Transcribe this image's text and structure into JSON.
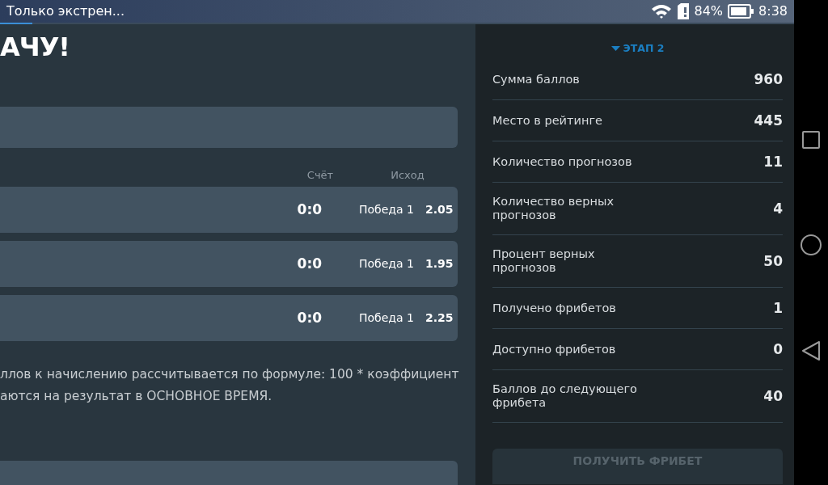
{
  "status_bar": {
    "notification": "Только экстрен...",
    "battery": "84%",
    "time": "8:38"
  },
  "main": {
    "title": "АЧУ!",
    "columns": [
      "Счёт",
      "Исход"
    ],
    "matches": [
      {
        "score": "0:0",
        "outcome": "Победа 1",
        "odds": "2.05"
      },
      {
        "score": "0:0",
        "outcome": "Победа 1",
        "odds": "1.95"
      },
      {
        "score": "0:0",
        "outcome": "Победа 1",
        "odds": "2.25"
      }
    ],
    "notes": [
      "ллов к начислению рассчитывается по формуле: 100 * коэффициент",
      "аются на результат в ОСНОВНОЕ ВРЕМЯ."
    ]
  },
  "panel": {
    "stage": {
      "label": "ЭТАП 2",
      "expanded": true
    },
    "stats": [
      {
        "label": "Сумма баллов",
        "value": "960"
      },
      {
        "label": "Место в рейтинге",
        "value": "445"
      },
      {
        "label": "Количество прогнозов",
        "value": "11"
      },
      {
        "label": "Количество верных прогнозов",
        "value": "4"
      },
      {
        "label": "Процент верных прогнозов",
        "value": "50"
      },
      {
        "label": "Получено фрибетов",
        "value": "1"
      },
      {
        "label": "Доступно фрибетов",
        "value": "0"
      },
      {
        "label": "Баллов до следующего фрибета",
        "value": "40"
      }
    ],
    "button": {
      "label": "ПОЛУЧИТЬ ФРИБЕТ",
      "disabled": true
    }
  }
}
